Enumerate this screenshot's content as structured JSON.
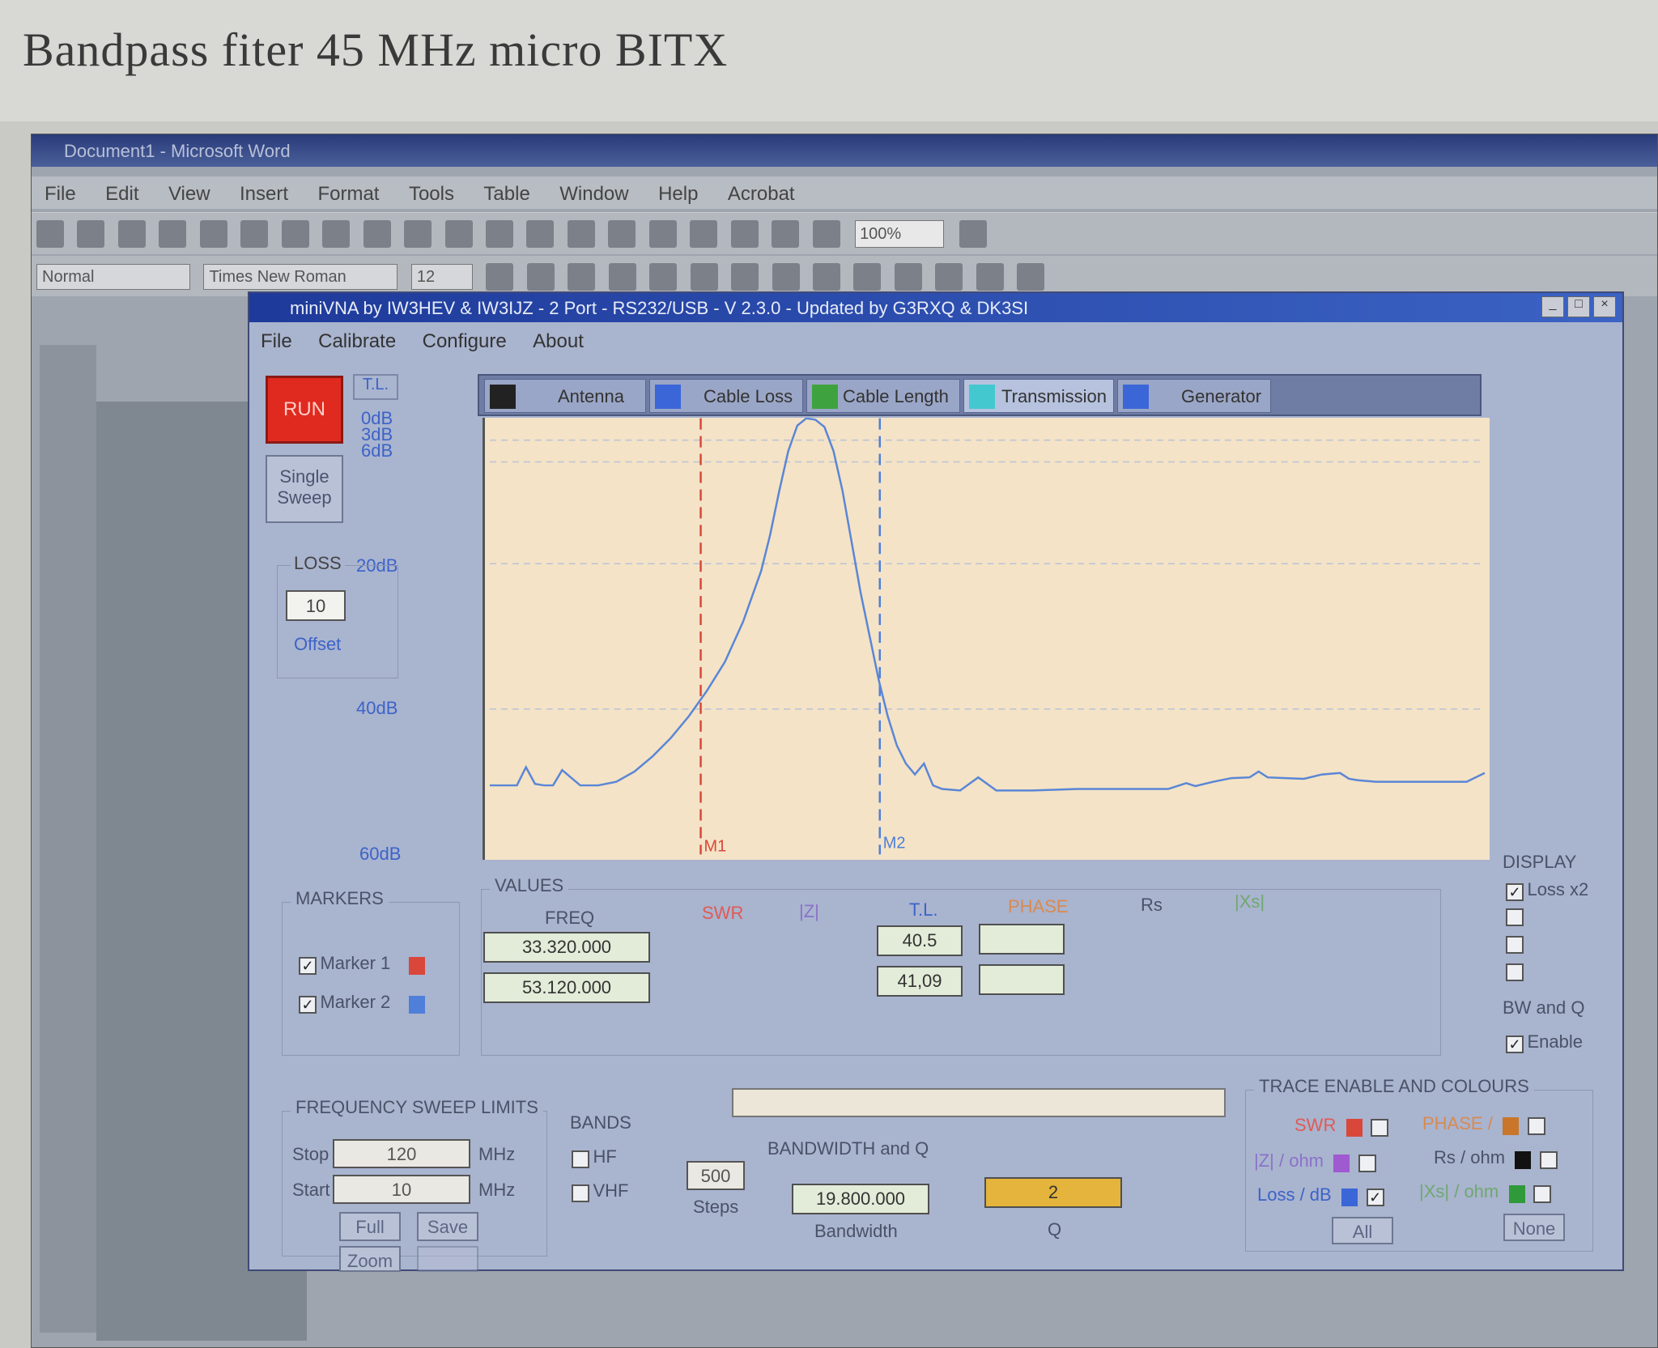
{
  "doc_heading": "Bandpass fiter 45 MHz  micro BITX",
  "word": {
    "title": "Document1 - Microsoft Word",
    "menu": [
      "File",
      "Edit",
      "View",
      "Insert",
      "Format",
      "Tools",
      "Table",
      "Window",
      "Help",
      "Acrobat"
    ],
    "zoom": "100%",
    "style": "Normal",
    "font": "Times New Roman",
    "font_size": "12"
  },
  "vna": {
    "title": "miniVNA by IW3HEV & IW3IJZ - 2 Port - RS232/USB - V 2.3.0 - Updated by G3RXQ & DK3SI",
    "menu": [
      "File",
      "Calibrate",
      "Configure",
      "About"
    ],
    "run": "RUN",
    "single_sweep": "Single Sweep",
    "tl_label": "T.L.",
    "scale_labels": {
      "a": "0dB",
      "b": "3dB",
      "c": "6dB",
      "d": "20dB",
      "e": "40dB",
      "f": "60dB"
    },
    "loss": {
      "title": "LOSS",
      "value": "10",
      "offset": "Offset"
    },
    "tabs": [
      "Antenna",
      "Cable Loss",
      "Cable Length",
      "Transmission",
      "Generator"
    ],
    "colors": {
      "plot_bg": "#f4e3c6",
      "trace": "#5a86d6",
      "marker1": "#d9473a",
      "marker2": "#4f7fd9",
      "run": "#e02a20"
    }
  },
  "chart_data": {
    "type": "line",
    "xlabel": "",
    "ylabel": "",
    "xlim": [
      10,
      120
    ],
    "ylim": [
      60,
      0
    ],
    "y_ticks": [
      "0dB",
      "3dB",
      "6dB",
      "20dB",
      "40dB",
      "60dB"
    ],
    "markers": [
      {
        "name": "M1",
        "x": 33.32
      },
      {
        "name": "M2",
        "x": 53.12
      }
    ],
    "series": [
      {
        "x": [
          10,
          13,
          14,
          15,
          16,
          17,
          18,
          20,
          22,
          24,
          26,
          28,
          30,
          32,
          34,
          36,
          38,
          40,
          41,
          42,
          43,
          44,
          45,
          46,
          47,
          48,
          49,
          50,
          51,
          52,
          53,
          54,
          55,
          56,
          57,
          58,
          59,
          60,
          62,
          64,
          66,
          70,
          75,
          80,
          85,
          87,
          88,
          90,
          92,
          94,
          95,
          96,
          98,
          100,
          102,
          104,
          105,
          106,
          108,
          110,
          112,
          114,
          116,
          118,
          120
        ],
        "y": [
          50.5,
          50.5,
          48.0,
          50.3,
          50.5,
          50.5,
          48.4,
          50.5,
          50.5,
          50.0,
          48.6,
          46.5,
          44.0,
          41.0,
          37.5,
          33.5,
          28.0,
          21.0,
          16.0,
          10.0,
          4.5,
          1.0,
          0.0,
          0.2,
          1.2,
          4.5,
          10.0,
          17.0,
          24.0,
          30.0,
          36.0,
          41.0,
          45.0,
          47.5,
          49.0,
          47.5,
          50.5,
          51.0,
          51.2,
          49.4,
          51.2,
          51.2,
          51.0,
          51.0,
          51.0,
          50.2,
          50.6,
          50.0,
          49.5,
          49.4,
          48.6,
          49.4,
          49.5,
          49.6,
          49.0,
          48.8,
          49.6,
          49.8,
          50.0,
          50.0,
          50.0,
          50.0,
          50.0,
          50.0,
          48.8
        ]
      }
    ]
  },
  "markers_panel": {
    "title": "MARKERS",
    "m1_label": "Marker 1",
    "m2_label": "Marker 2",
    "m1_checked": "✓",
    "m2_checked": "✓"
  },
  "values_panel": {
    "title": "VALUES",
    "freq_hdr": "FREQ",
    "swr_hdr": "SWR",
    "z_hdr": "|Z|",
    "tl_hdr": "T.L.",
    "phase_hdr": "PHASE",
    "rs_hdr": "Rs",
    "xs_hdr": "|Xs|",
    "m1_freq": "33.320.000",
    "m2_freq": "53.120.000",
    "m1_tl": "40.5",
    "m2_tl": "41,09"
  },
  "display_panel": {
    "title": "DISPLAY",
    "loss_x2": "Loss x2",
    "loss_x2_checked": "✓",
    "bw_title": "BW and Q",
    "enable": "Enable",
    "enable_checked": "✓"
  },
  "sweep_panel": {
    "title": "FREQUENCY SWEEP LIMITS",
    "stop_lbl": "Stop",
    "stop_val": "120",
    "start_lbl": "Start",
    "start_val": "10",
    "unit": "MHz",
    "full": "Full",
    "save": "Save",
    "zoom": "Zoom"
  },
  "bands_panel": {
    "title": "BANDS",
    "hf": "HF",
    "vhf": "VHF",
    "steps_val": "500",
    "steps_lbl": "Steps"
  },
  "bw_panel": {
    "title": "BANDWIDTH and Q",
    "bandwidth_val": "19.800.000",
    "bandwidth_lbl": "Bandwidth",
    "q_val": "2",
    "q_lbl": "Q"
  },
  "trace_panel": {
    "title": "TRACE ENABLE AND COLOURS",
    "swr": "SWR",
    "z": "|Z| / ohm",
    "loss": "Loss / dB",
    "loss_checked": "✓",
    "phase": "PHASE /",
    "rs": "Rs / ohm",
    "xs": "|Xs| / ohm",
    "all": "All",
    "none": "None"
  }
}
